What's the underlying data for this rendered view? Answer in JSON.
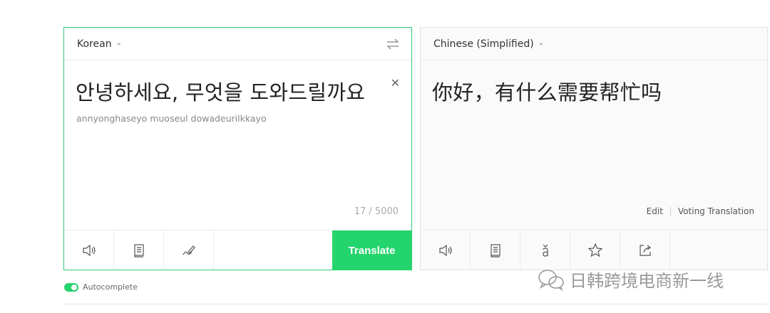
{
  "source": {
    "language": "Korean",
    "text": "안녕하세요, 무엇을 도와드릴까요",
    "romanization": "annyonghaseyo muoseul dowadeurilkkayo",
    "counter": "17 / 5000",
    "translate_label": "Translate",
    "footer_icons": [
      "speaker-icon",
      "document-icon",
      "handwriting-icon"
    ]
  },
  "target": {
    "language": "Chinese (Simplified)",
    "text": "你好，有什么需要帮忙吗",
    "edit_label": "Edit",
    "voting_label": "Voting Translation",
    "footer_icons": [
      "speaker-icon",
      "document-icon",
      "pinyin-icon",
      "star-icon",
      "share-icon"
    ]
  },
  "autocomplete": {
    "label": "Autocomplete",
    "enabled": true
  },
  "watermark": {
    "text": "日韩跨境电商新一线"
  },
  "colors": {
    "accent": "#24d46c",
    "border_active": "#33c77a"
  }
}
